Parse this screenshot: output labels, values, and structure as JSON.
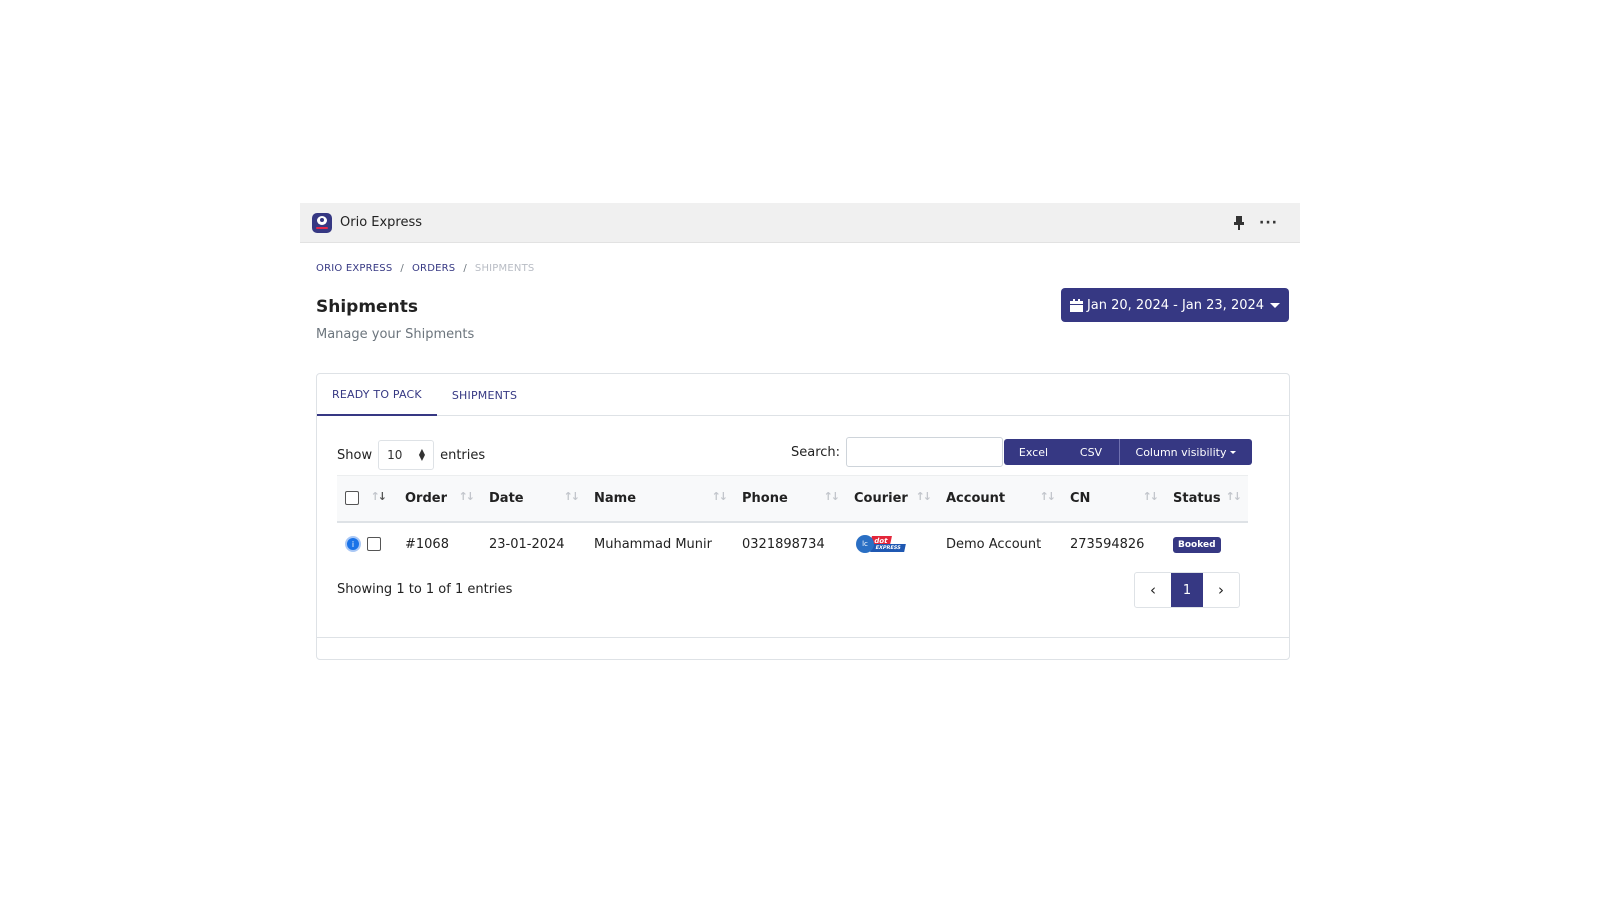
{
  "app": {
    "title": "Orio Express",
    "logo_icon": "orio-express-logo",
    "brand_color": "#363883"
  },
  "titlebar": {
    "pin_icon": "pin-icon",
    "more_icon": "more-icon",
    "more_glyph": "···"
  },
  "breadcrumb": {
    "items": [
      "ORIO EXPRESS",
      "ORDERS",
      "SHIPMENTS"
    ],
    "separator": "/"
  },
  "header": {
    "title": "Shipments",
    "subtitle": "Manage your Shipments",
    "date_range": "Jan 20, 2024 - Jan 23, 2024"
  },
  "tabs": [
    {
      "label": "READY TO PACK",
      "active": true
    },
    {
      "label": "SHIPMENTS",
      "active": false
    }
  ],
  "table_controls": {
    "show_label": "Show",
    "entries_label": "entries",
    "page_length": "10",
    "search_label": "Search:",
    "search_value": "",
    "buttons": {
      "excel": "Excel",
      "csv": "CSV",
      "column_visibility": "Column visibility"
    }
  },
  "table": {
    "columns": [
      "",
      "Order",
      "Date",
      "Name",
      "Phone",
      "Courier",
      "Account",
      "CN",
      "Status"
    ],
    "rows": [
      {
        "order": "#1068",
        "date": "23-01-2024",
        "name": "Muhammad Munir",
        "phone": "0321898734",
        "courier": {
          "logo": "leopards-dot-express-logo",
          "text_top": "dot",
          "text_bottom": "EXPRESS",
          "circle": "lc"
        },
        "account": "Demo Account",
        "cn": "273594826",
        "status": "Booked",
        "status_color": "#363883"
      }
    ]
  },
  "footer": {
    "info": "Showing 1 to 1 of 1 entries",
    "pagination": {
      "prev": "‹",
      "current": "1",
      "next": "›"
    }
  }
}
